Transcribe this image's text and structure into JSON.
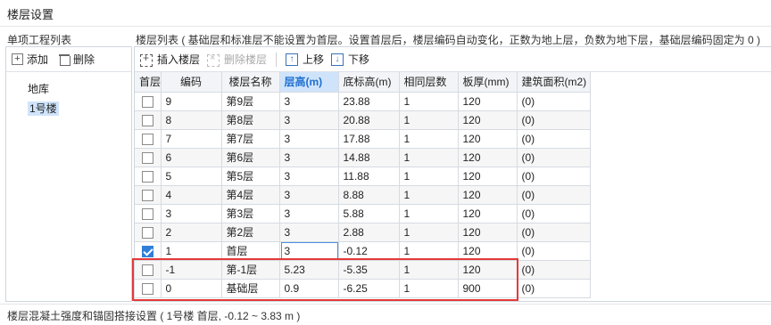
{
  "title": "楼层设置",
  "left": {
    "label": "单项工程列表",
    "add_label": "添加",
    "delete_label": "删除",
    "items": [
      {
        "label": "地库",
        "selected": false
      },
      {
        "label": "1号楼",
        "selected": true
      }
    ]
  },
  "right": {
    "label": "楼层列表 ( 基础层和标准层不能设置为首层。设置首层后，楼层编码自动变化，正数为地上层，负数为地下层，基础层编码固定为 0 )",
    "toolbar": {
      "insert_label": "插入楼层",
      "delete_label": "删除楼层",
      "up_label": "上移",
      "down_label": "下移"
    },
    "columns": [
      "首层",
      "编码",
      "楼层名称",
      "层高(m)",
      "底标高(m)",
      "相同层数",
      "板厚(mm)",
      "建筑面积(m2)"
    ],
    "rows": [
      {
        "checked": false,
        "code": "9",
        "name": "第9层",
        "height": "3",
        "bottom": "23.88",
        "same": "1",
        "thick": "120",
        "area": "(0)"
      },
      {
        "checked": false,
        "code": "8",
        "name": "第8层",
        "height": "3",
        "bottom": "20.88",
        "same": "1",
        "thick": "120",
        "area": "(0)"
      },
      {
        "checked": false,
        "code": "7",
        "name": "第7层",
        "height": "3",
        "bottom": "17.88",
        "same": "1",
        "thick": "120",
        "area": "(0)"
      },
      {
        "checked": false,
        "code": "6",
        "name": "第6层",
        "height": "3",
        "bottom": "14.88",
        "same": "1",
        "thick": "120",
        "area": "(0)"
      },
      {
        "checked": false,
        "code": "5",
        "name": "第5层",
        "height": "3",
        "bottom": "11.88",
        "same": "1",
        "thick": "120",
        "area": "(0)"
      },
      {
        "checked": false,
        "code": "4",
        "name": "第4层",
        "height": "3",
        "bottom": "8.88",
        "same": "1",
        "thick": "120",
        "area": "(0)"
      },
      {
        "checked": false,
        "code": "3",
        "name": "第3层",
        "height": "3",
        "bottom": "5.88",
        "same": "1",
        "thick": "120",
        "area": "(0)"
      },
      {
        "checked": false,
        "code": "2",
        "name": "第2层",
        "height": "3",
        "bottom": "2.88",
        "same": "1",
        "thick": "120",
        "area": "(0)"
      },
      {
        "checked": true,
        "code": "1",
        "name": "首层",
        "height": "3",
        "bottom": "-0.12",
        "same": "1",
        "thick": "120",
        "area": "(0)"
      },
      {
        "checked": false,
        "code": "-1",
        "name": "第-1层",
        "height": "5.23",
        "bottom": "-5.35",
        "same": "1",
        "thick": "120",
        "area": "(0)"
      },
      {
        "checked": false,
        "code": "0",
        "name": "基础层",
        "height": "0.9",
        "bottom": "-6.25",
        "same": "1",
        "thick": "900",
        "area": "(0)"
      }
    ]
  },
  "bottom_label": "楼层混凝土强度和锚固搭接设置 ( 1号楼  首层, -0.12 ~ 3.83 m )",
  "colors": {
    "accent": "#2f7fd8",
    "highlight_box": "#e53a3a",
    "header_highlight": "#cfe4fb"
  }
}
